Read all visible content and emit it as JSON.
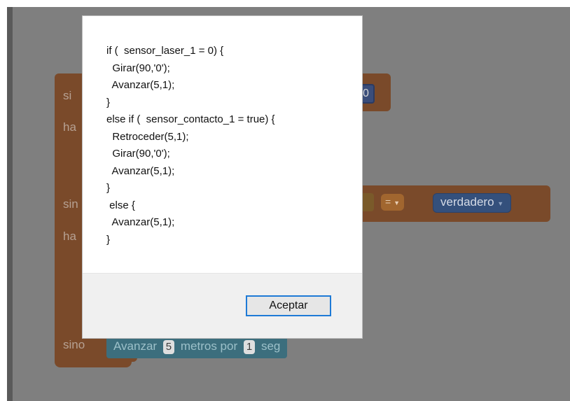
{
  "workspace": {
    "if_label": "si",
    "do_label_1": "ha",
    "elseif_label": "sin",
    "do_label_2": "ha",
    "else_label": "sino",
    "laser_value": "0",
    "compare_op": "=",
    "contact_value": "verdadero",
    "else_action": {
      "prefix": "Avanzar",
      "distance": "5",
      "middle": "metros por",
      "time": "1",
      "suffix": "seg"
    }
  },
  "dialog": {
    "code": "if (  sensor_laser_1 = 0) {\n  Girar(90,'0');\n  Avanzar(5,1);\n}\nelse if (  sensor_contacto_1 = true) {\n  Retroceder(5,1);\n  Girar(90,'0');\n  Avanzar(5,1);\n}\n else {\n  Avanzar(5,1);\n}",
    "accept_label": "Aceptar"
  },
  "colors": {
    "overlay": "#7f7f7f",
    "accent": "#1e7ad6"
  }
}
